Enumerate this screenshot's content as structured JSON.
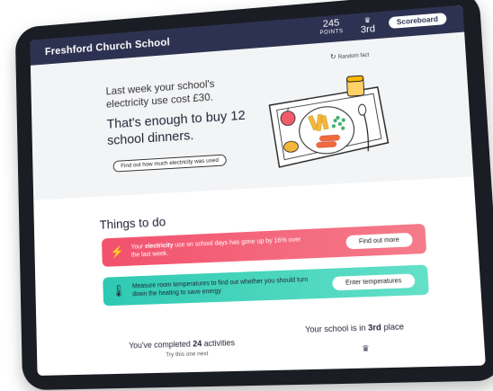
{
  "topbar": {
    "school_name": "Freshford Church School",
    "points_value": "245",
    "points_label": "POINTS",
    "rank": "3rd",
    "scoreboard_label": "Scoreboard"
  },
  "hero": {
    "random_fact_label": "Random fact",
    "lead_text": "Last week your school's electricity use cost £30.",
    "big_text": "That's enough to buy 12 school dinners.",
    "find_out_label": "Find out how much electricity was used"
  },
  "things": {
    "title": "Things to do",
    "cards": [
      {
        "text_pre": "Your ",
        "text_bold": "electricity",
        "text_post": " use on school days has gone up by 16% over the last week.",
        "button": "Find out more",
        "icon": "lightning-icon"
      },
      {
        "text": "Measure room temperatures to find out whether you should turn down the heating to save energy",
        "button": "Enter temperatures",
        "icon": "thermometer-icon"
      }
    ]
  },
  "bottom": {
    "completed_pre": "You've completed ",
    "completed_count": "24",
    "completed_post": " activities",
    "try_next": "Try this one next",
    "place_pre": "Your school is in ",
    "place_rank": "3rd",
    "place_post": " place"
  },
  "colors": {
    "header": "#2e3252",
    "pink": "#f2506d",
    "teal": "#2ec9b2"
  }
}
